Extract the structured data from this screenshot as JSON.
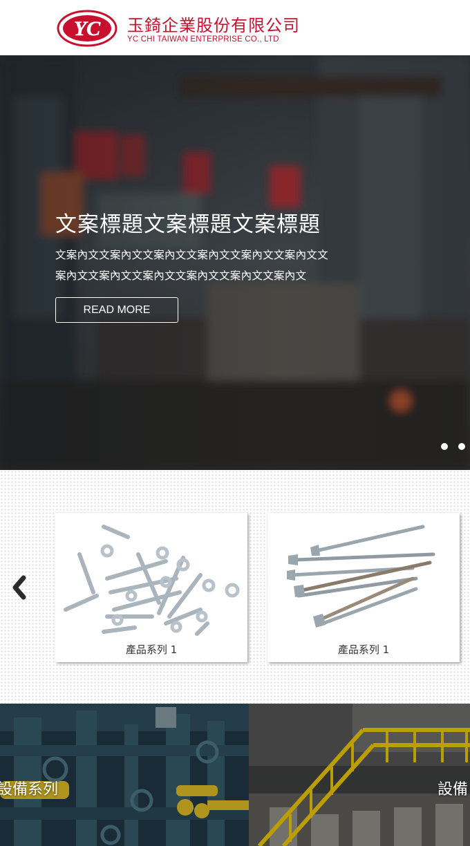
{
  "header": {
    "logo_text": "YC",
    "company_name_cn": "玉錡企業股份有限公司",
    "company_name_en": "YC CHI TAIWAN ENTERPRISE CO., LTD"
  },
  "hero": {
    "title": "文案標題文案標題文案標題",
    "body": "文案內文文案內文文案內文文案內文文案內文文案內文文案內文文案內文文案內文文案內文文案內文文案內文",
    "button_label": "READ MORE",
    "slide_count": 2
  },
  "products": {
    "prev_icon": "chevron-left-icon",
    "items": [
      {
        "label": "產品系列 1",
        "image": "bolts-and-washers"
      },
      {
        "label": "產品系列 1",
        "image": "wood-screws"
      }
    ]
  },
  "categories": [
    {
      "label": "設備系列"
    },
    {
      "label": "設備"
    }
  ],
  "colors": {
    "brand_red": "#c8102e",
    "hero_overlay": "#1e252b",
    "category_yellow": "#f2c200"
  }
}
